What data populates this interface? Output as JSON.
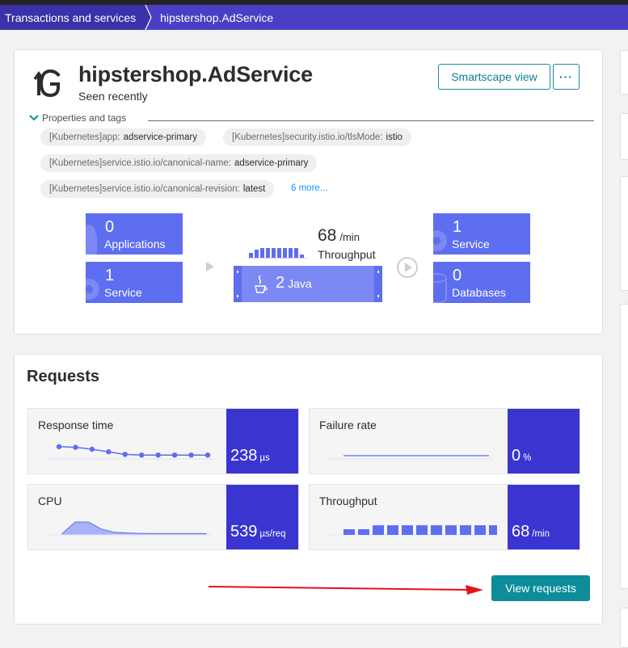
{
  "breadcrumb": {
    "items": [
      "Transactions and services",
      "hipstershop.AdService"
    ]
  },
  "service": {
    "name": "hipstershop.AdService",
    "status": "Seen recently",
    "smartscape_button": "Smartscape view",
    "more_button": "···"
  },
  "properties": {
    "toggle_label": "Properties and tags",
    "tags": [
      {
        "key": "[Kubernetes]app:",
        "value": "adservice-primary"
      },
      {
        "key": "[Kubernetes]security.istio.io/tlsMode:",
        "value": "istio"
      },
      {
        "key": "[Kubernetes]service.istio.io/canonical-name:",
        "value": "adservice-primary"
      },
      {
        "key": "[Kubernetes]service.istio.io/canonical-revision:",
        "value": "latest"
      }
    ],
    "more_link": "6 more..."
  },
  "flow": {
    "callers": [
      {
        "count": "0",
        "label": "Applications"
      },
      {
        "count": "1",
        "label": "Service"
      }
    ],
    "throughput": {
      "value": "68",
      "unit": "/min",
      "label": "Throughput",
      "bars": [
        0.45,
        0.7,
        0.85,
        0.85,
        0.85,
        0.85,
        0.85,
        0.85,
        0.85,
        0.3
      ]
    },
    "process": {
      "count": "2",
      "tech": "Java"
    },
    "callees": [
      {
        "count": "1",
        "label": "Service"
      },
      {
        "count": "0",
        "label": "Databases"
      }
    ]
  },
  "requests": {
    "title": "Requests",
    "metrics": [
      {
        "name": "Response time",
        "value": "238",
        "unit": "µs",
        "series": [
          0.95,
          0.9,
          0.75,
          0.55,
          0.35,
          0.3,
          0.3,
          0.3,
          0.3,
          0.3
        ]
      },
      {
        "name": "Failure rate",
        "value": "0",
        "unit": "%",
        "series": [
          0,
          0,
          0,
          0,
          0,
          0,
          0,
          0,
          0,
          0
        ]
      },
      {
        "name": "CPU",
        "value": "539",
        "unit": "µs/req",
        "series": [
          0.1,
          1.0,
          1.0,
          0.45,
          0.2,
          0.15,
          0.12,
          0.1,
          0.1,
          0.1,
          0.1,
          0.1
        ]
      },
      {
        "name": "Throughput",
        "value": "68",
        "unit": "/min",
        "series": [
          0.5,
          0.5,
          0.85,
          0.85,
          0.85,
          0.85,
          0.85,
          0.85,
          0.85,
          0.85,
          0.85,
          0.1
        ]
      }
    ],
    "view_button": "View requests"
  },
  "colors": {
    "accent": "#3a35d0",
    "tile": "#5e6ef0",
    "button": "#0d8c99",
    "breadcrumb": "#4a3fc4",
    "annotation_arrow": "#e3101a"
  }
}
